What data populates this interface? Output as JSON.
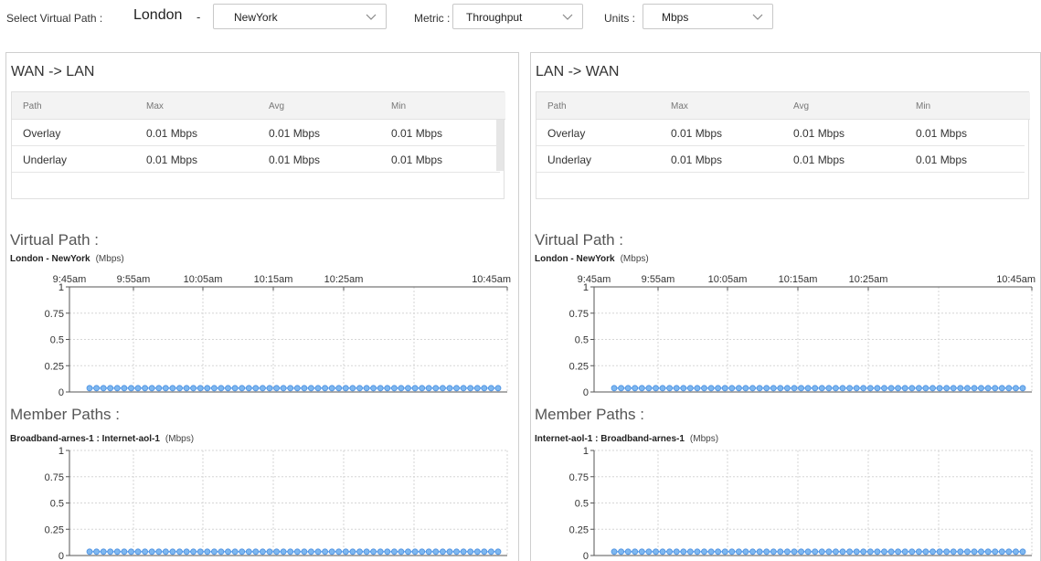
{
  "toolbar": {
    "vp_label": "Select Virtual Path :",
    "site_from": "London",
    "dash": "-",
    "site_to_select": "NewYork",
    "metric_label": "Metric :",
    "metric_value": "Throughput",
    "units_label": "Units :",
    "units_value": "Mbps"
  },
  "table_headers": [
    "Path",
    "Max",
    "Avg",
    "Min"
  ],
  "panels": [
    {
      "title": "WAN -> LAN",
      "rows": [
        [
          "Overlay",
          "0.01 Mbps",
          "0.01 Mbps",
          "0.01 Mbps"
        ],
        [
          "Underlay",
          "0.01 Mbps",
          "0.01 Mbps",
          "0.01 Mbps"
        ]
      ],
      "vp_section": "Virtual Path :",
      "vp_chart_name": "London - NewYork",
      "mp_section": "Member Paths :",
      "mp_chart_name": "Broadband-arnes-1 : Internet-aol-1",
      "unit": "(Mbps)"
    },
    {
      "title": "LAN -> WAN",
      "rows": [
        [
          "Overlay",
          "0.01 Mbps",
          "0.01 Mbps",
          "0.01 Mbps"
        ],
        [
          "Underlay",
          "0.01 Mbps",
          "0.01 Mbps",
          "0.01 Mbps"
        ]
      ],
      "vp_section": "Virtual Path :",
      "vp_chart_name": "London - NewYork",
      "mp_section": "Member Paths :",
      "mp_chart_name": "Internet-aol-1 : Broadband-arnes-1",
      "unit": "(Mbps)"
    }
  ],
  "chart_data": [
    {
      "type": "line",
      "title": "London - NewYork",
      "unit": "(Mbps)",
      "x_ticks": [
        "9:45am",
        "9:55am",
        "10:05am",
        "10:15am",
        "10:25am",
        "10:45am"
      ],
      "y_ticks": [
        "1",
        "0.75",
        "0.5",
        "0.25",
        "0"
      ],
      "ylim": [
        0,
        1
      ],
      "grid": true,
      "series": [
        {
          "values": [
            0.01,
            0.01,
            0.01,
            0.01,
            0.01,
            0.01,
            0.01,
            0.01,
            0.01,
            0.01,
            0.01,
            0.01,
            0.01,
            0.01,
            0.01,
            0.01,
            0.01,
            0.01,
            0.01,
            0.01,
            0.01,
            0.01,
            0.01,
            0.01,
            0.01,
            0.01,
            0.01,
            0.01,
            0.01,
            0.01,
            0.01,
            0.01,
            0.01,
            0.01,
            0.01,
            0.01,
            0.01,
            0.01,
            0.01,
            0.01,
            0.01,
            0.01,
            0.01,
            0.01,
            0.01,
            0.01,
            0.01,
            0.01,
            0.01,
            0.01,
            0.01,
            0.01,
            0.01,
            0.01,
            0.01,
            0.01,
            0.01,
            0.01,
            0.01,
            0.01
          ]
        }
      ]
    },
    {
      "type": "line",
      "title": "Broadband-arnes-1 : Internet-aol-1",
      "unit": "(Mbps)",
      "x_ticks": [],
      "y_ticks": [
        "1",
        "0.75",
        "0.5",
        "0.25",
        "0"
      ],
      "ylim": [
        0,
        1
      ],
      "grid": true,
      "series": [
        {
          "values": [
            0.01,
            0.01,
            0.01,
            0.01,
            0.01,
            0.01,
            0.01,
            0.01,
            0.01,
            0.01,
            0.01,
            0.01,
            0.01,
            0.01,
            0.01,
            0.01,
            0.01,
            0.01,
            0.01,
            0.01,
            0.01,
            0.01,
            0.01,
            0.01,
            0.01,
            0.01,
            0.01,
            0.01,
            0.01,
            0.01,
            0.01,
            0.01,
            0.01,
            0.01,
            0.01,
            0.01,
            0.01,
            0.01,
            0.01,
            0.01,
            0.01,
            0.01,
            0.01,
            0.01,
            0.01,
            0.01,
            0.01,
            0.01,
            0.01,
            0.01,
            0.01,
            0.01,
            0.01,
            0.01,
            0.01,
            0.01,
            0.01,
            0.01,
            0.01,
            0.01
          ]
        }
      ]
    },
    {
      "type": "line",
      "title": "London - NewYork",
      "unit": "(Mbps)",
      "x_ticks": [
        "9:45am",
        "9:55am",
        "10:05am",
        "10:15am",
        "10:25am",
        "10:45am"
      ],
      "y_ticks": [
        "1",
        "0.75",
        "0.5",
        "0.25",
        "0"
      ],
      "ylim": [
        0,
        1
      ],
      "grid": true,
      "series": [
        {
          "values": [
            0.01,
            0.01,
            0.01,
            0.01,
            0.01,
            0.01,
            0.01,
            0.01,
            0.01,
            0.01,
            0.01,
            0.01,
            0.01,
            0.01,
            0.01,
            0.01,
            0.01,
            0.01,
            0.01,
            0.01,
            0.01,
            0.01,
            0.01,
            0.01,
            0.01,
            0.01,
            0.01,
            0.01,
            0.01,
            0.01,
            0.01,
            0.01,
            0.01,
            0.01,
            0.01,
            0.01,
            0.01,
            0.01,
            0.01,
            0.01,
            0.01,
            0.01,
            0.01,
            0.01,
            0.01,
            0.01,
            0.01,
            0.01,
            0.01,
            0.01,
            0.01,
            0.01,
            0.01,
            0.01,
            0.01,
            0.01,
            0.01,
            0.01,
            0.01,
            0.01
          ]
        }
      ]
    },
    {
      "type": "line",
      "title": "Internet-aol-1 : Broadband-arnes-1",
      "unit": "(Mbps)",
      "x_ticks": [],
      "y_ticks": [
        "1",
        "0.75",
        "0.5",
        "0.25",
        "0"
      ],
      "ylim": [
        0,
        1
      ],
      "grid": true,
      "series": [
        {
          "values": [
            0.01,
            0.01,
            0.01,
            0.01,
            0.01,
            0.01,
            0.01,
            0.01,
            0.01,
            0.01,
            0.01,
            0.01,
            0.01,
            0.01,
            0.01,
            0.01,
            0.01,
            0.01,
            0.01,
            0.01,
            0.01,
            0.01,
            0.01,
            0.01,
            0.01,
            0.01,
            0.01,
            0.01,
            0.01,
            0.01,
            0.01,
            0.01,
            0.01,
            0.01,
            0.01,
            0.01,
            0.01,
            0.01,
            0.01,
            0.01,
            0.01,
            0.01,
            0.01,
            0.01,
            0.01,
            0.01,
            0.01,
            0.01,
            0.01,
            0.01,
            0.01,
            0.01,
            0.01,
            0.01,
            0.01,
            0.01,
            0.01,
            0.01,
            0.01,
            0.01
          ]
        }
      ]
    }
  ],
  "colors": {
    "series_line": "#4a90e2",
    "series_marker": "#7fb8f0",
    "grid": "#d6d6d6",
    "axis": "#555555"
  }
}
